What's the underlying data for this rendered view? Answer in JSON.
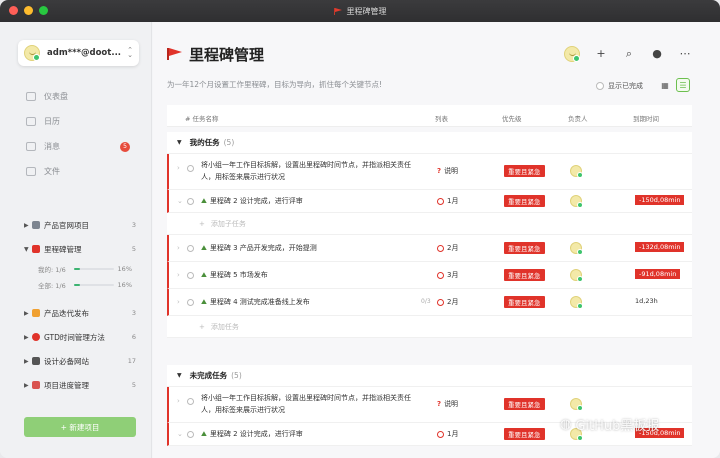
{
  "window": {
    "title": "里程碑管理"
  },
  "user": {
    "name": "adm***@doot..."
  },
  "nav": [
    {
      "label": "仪表盘",
      "icon": "dashboard-icon"
    },
    {
      "label": "日历",
      "icon": "calendar-icon"
    },
    {
      "label": "消息",
      "icon": "message-icon",
      "badge": "5"
    },
    {
      "label": "文件",
      "icon": "file-icon"
    }
  ],
  "projects": [
    {
      "label": "产品官网项目",
      "count": "3",
      "color": "#7d8590"
    },
    {
      "label": "里程碑管理",
      "count": "5",
      "color": "#e0332a"
    },
    {
      "label": "产品迭代发布",
      "count": "3",
      "color": "#f0a030"
    },
    {
      "label": "GTD时间管理方法",
      "count": "6",
      "color": "#e0332a"
    },
    {
      "label": "设计必备网站",
      "count": "17",
      "color": "#555"
    },
    {
      "label": "项目进度管理",
      "count": "5",
      "color": "#d9534f"
    }
  ],
  "progress": [
    {
      "label": "我的: 1/6",
      "pct": "16%",
      "fraction": 0.16
    },
    {
      "label": "全部: 1/6",
      "pct": "16%",
      "fraction": 0.16
    }
  ],
  "new_project": "+ 新建项目",
  "page": {
    "title": "里程碑管理",
    "desc": "为一年12个月设置工作里程碑，目标为导向，抓住每个关键节点!",
    "show_done": "显示已完成"
  },
  "columns": {
    "name": "# 任务名称",
    "stage": "列表",
    "priority": "优先级",
    "owner": "负责人",
    "due": "到期时间"
  },
  "groups": [
    {
      "title": "我的任务",
      "count": "(5)",
      "add_sub": "添加子任务",
      "add_task": "添加任务",
      "rows": [
        {
          "name": "将小组一年工作目标拆解，设置出里程碑时间节点，并指派相关责任人，用标签来展示进行状况",
          "stage": "说明",
          "priority": "重要且紧急",
          "due": ""
        },
        {
          "name": "里程碑 2 设计完成，进行评审",
          "stage": "1月",
          "priority": "重要且紧急",
          "due": "-150d,08min"
        },
        {
          "name": "里程碑 3 产品开发完成，开始提测",
          "stage": "2月",
          "priority": "重要且紧急",
          "due": "-132d,08min"
        },
        {
          "name": "里程碑 5 市场发布",
          "stage": "3月",
          "priority": "重要且紧急",
          "due": "-91d,08min"
        },
        {
          "name": "里程碑 4 测试完成准备线上发布",
          "subinfo": "0/3",
          "stage": "2月",
          "priority": "重要且紧急",
          "due": "1d,23h"
        }
      ]
    },
    {
      "title": "未完成任务",
      "count": "(5)",
      "rows": [
        {
          "name": "将小组一年工作目标拆解，设置出里程碑时间节点，并指派相关责任人，用标签来展示进行状况",
          "stage": "说明",
          "priority": "重要且紧急",
          "due": ""
        },
        {
          "name": "里程碑 2 设计完成，进行评审",
          "stage": "1月",
          "priority": "重要且紧急",
          "due": "-150d,08min"
        }
      ]
    }
  ],
  "watermark": "GitHub黑板报"
}
